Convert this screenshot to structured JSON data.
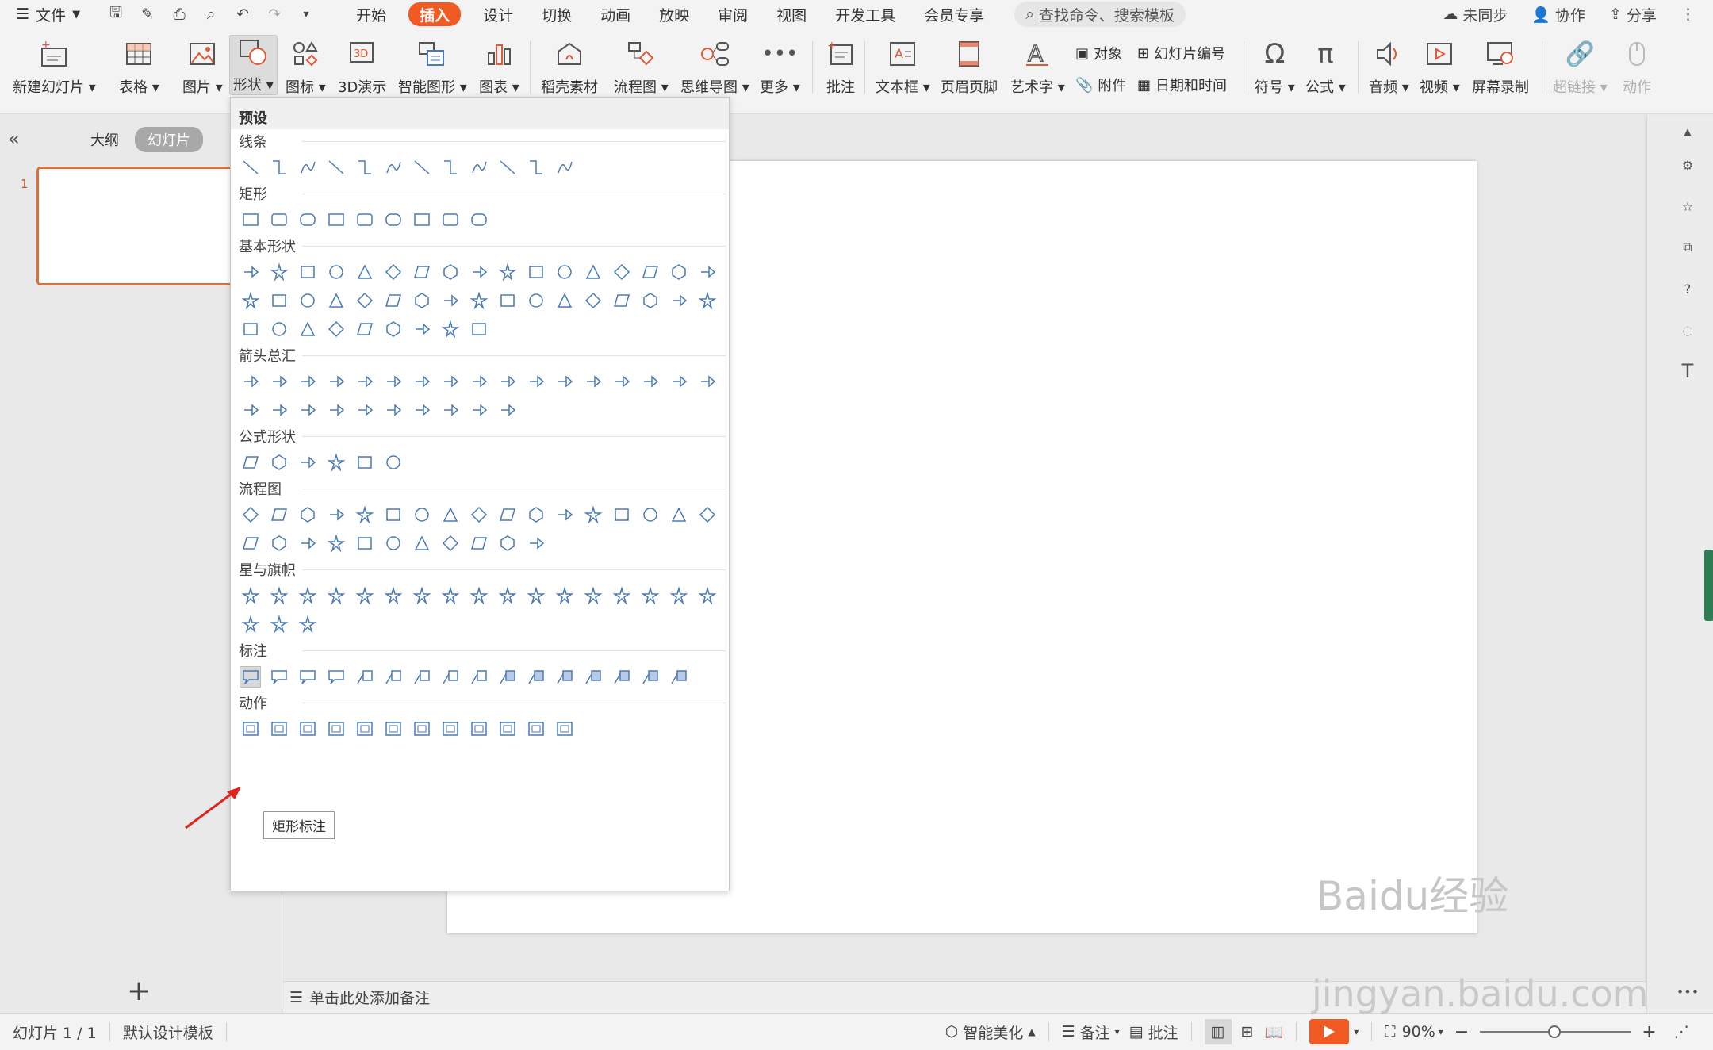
{
  "menubar": {
    "file_label": "文件",
    "tabs": [
      "开始",
      "插入",
      "设计",
      "切换",
      "动画",
      "放映",
      "审阅",
      "视图",
      "开发工具",
      "会员专享"
    ],
    "active_tab": "插入",
    "search_placeholder": "查找命令、搜索模板",
    "sync_label": "未同步",
    "collab_label": "协作",
    "share_label": "分享"
  },
  "ribbon": {
    "new_slide": "新建幻灯片",
    "table": "表格",
    "picture": "图片",
    "shape": "形状",
    "icon": "图标",
    "demo3d": "3D演示",
    "smartart": "智能图形",
    "chart": "图表",
    "daoke": "稻壳素材",
    "flowchart": "流程图",
    "mindmap": "思维导图",
    "more": "更多",
    "comment": "批注",
    "textbox": "文本框",
    "header_footer": "页眉页脚",
    "wordart": "艺术字",
    "object": "对象",
    "attachment": "附件",
    "slide_number": "幻灯片编号",
    "datetime": "日期和时间",
    "symbol": "符号",
    "formula": "公式",
    "audio": "音频",
    "video": "视频",
    "screen_record": "屏幕录制",
    "hyperlink": "超链接",
    "action": "动作"
  },
  "leftpane": {
    "tab_outline": "大纲",
    "tab_slides": "幻灯片",
    "slide_number": "1"
  },
  "shapes_panel": {
    "header": "预设",
    "sections": [
      {
        "title": "线条",
        "rows": [
          12
        ]
      },
      {
        "title": "矩形",
        "rows": [
          9
        ]
      },
      {
        "title": "基本形状",
        "rows": [
          17,
          17,
          9
        ]
      },
      {
        "title": "箭头总汇",
        "rows": [
          17,
          10
        ]
      },
      {
        "title": "公式形状",
        "rows": [
          6
        ]
      },
      {
        "title": "流程图",
        "rows": [
          17,
          11
        ]
      },
      {
        "title": "星与旗帜",
        "rows": [
          17,
          3
        ]
      },
      {
        "title": "标注",
        "rows": [
          16
        ]
      },
      {
        "title": "动作",
        "rows": [
          12
        ]
      }
    ],
    "tooltip": "矩形标注"
  },
  "notes": {
    "placeholder": "单击此处添加备注"
  },
  "statusbar": {
    "slide_info": "幻灯片 1 / 1",
    "template": "默认设计模板",
    "smart_beautify": "智能美化",
    "notes": "备注",
    "comments": "批注",
    "zoom": "90%"
  },
  "watermark": {
    "line1": "Baidu经验",
    "line2": "jingyan.baidu.com"
  },
  "colors": {
    "accent": "#f25a24",
    "shape_stroke": "#4a7ab8",
    "thumb_border": "#e16e3b"
  }
}
